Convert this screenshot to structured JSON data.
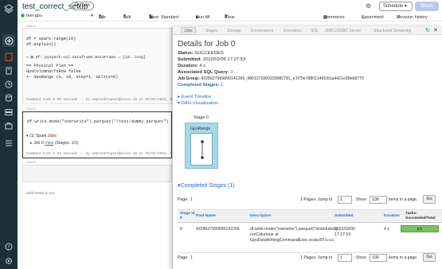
{
  "app": {
    "title": "test_correct_setup",
    "language": "Python",
    "schedule_label": "Schedule",
    "share_label": "Share",
    "comments_label": "Comments",
    "experiment_label": "Experiment",
    "revision_label": "Revision history"
  },
  "toolbar": {
    "cluster": "test-gpu",
    "file": "File",
    "edit": "Edit",
    "view": "View: Standard",
    "run_all": "Run All",
    "clear": "Clear"
  },
  "notebook": {
    "cells": [
      {
        "cmd": "Cmd 1",
        "code": [
          "df = spark.range(10)",
          "df.explain()"
        ],
        "output": [
          "df:  pyspark.sql.dataframe.DataFrame = [id: long]",
          "== Physical Plan ==",
          "GpuColumnarToRow false",
          "+- GpuRange (0, 10, step=1, splits=8)"
        ],
        "status": "Command took 0.80 seconds -- by amazonbrowser@inves.de at 05/02/2022, 5:41:52 PM on test-gpu"
      },
      {
        "cmd": "Cmd 2",
        "code": "df.write.mode(\"overwrite\").parquet(\"/test/dummy.parquet\")",
        "output": [
          "(1) Spark Jobs",
          "Job 0",
          "View",
          "(Stages: 1/1)"
        ],
        "status": "Command took 5.34 seconds -- by amazonbrowser@inves.de at 05/02/2022, 5:43:14 PM on test-gpu"
      },
      {
        "cmd": "Cmd 3",
        "hint": "Shift+Enter to run"
      }
    ]
  },
  "sparkui": {
    "tabs": [
      "Jobs",
      "Stages",
      "Storage",
      "Environment",
      "Executors",
      "SQL",
      "JDBC/ODBC Server",
      "Structured Streaming"
    ],
    "heading": "Details for Job 0",
    "status_label": "Status:",
    "status_value": "SUCCEEDED",
    "submitted_label": "Submitted:",
    "submitted_value": "2022/02/06 17:27:53",
    "duration_label": "Duration:",
    "duration_value": "4 s",
    "sql_label": "Associated SQL Query:",
    "sql_value": "3",
    "group_label": "Job Group:",
    "group_value": "4228627999890142266_4801371899339982781_e1f75e78801146f1b1a4421e39eb8770",
    "completed_label": "Completed Stages:",
    "completed_value": "1",
    "event_timeline": "Event Timeline",
    "dag_visualization": "DAG Visualization",
    "dag_stage": "Stage 0",
    "dag_op": "GpuRange",
    "completed_section": "Completed Stages (1)",
    "pager": {
      "page_label": "Page:",
      "page_num": "1",
      "pages_text": "1 Pages. Jump to",
      "jump_value": "1",
      "show_label": ". Show",
      "show_value": "100",
      "items_text": "items in a page.",
      "go": "Go"
    },
    "table": {
      "headers": [
        "Stage Id ▾",
        "Pool Name",
        "Description",
        "Submitted",
        "Duration",
        "Tasks: Succeeded/Total"
      ],
      "row": {
        "id": "0",
        "pool": "4228627999890142266",
        "desc1": "df.write.mode(\"overwrite\").parquet(\"/test/dummy...",
        "desc2": "runColumnar at",
        "desc3": "GpuDataWritingCommandExec.scala:87",
        "details": "+details",
        "submitted1": "2022/02/06",
        "submitted2": "17:27:53",
        "duration": "4 s",
        "tasks": "8/8",
        "tasks_fraction": 1.0
      }
    }
  }
}
